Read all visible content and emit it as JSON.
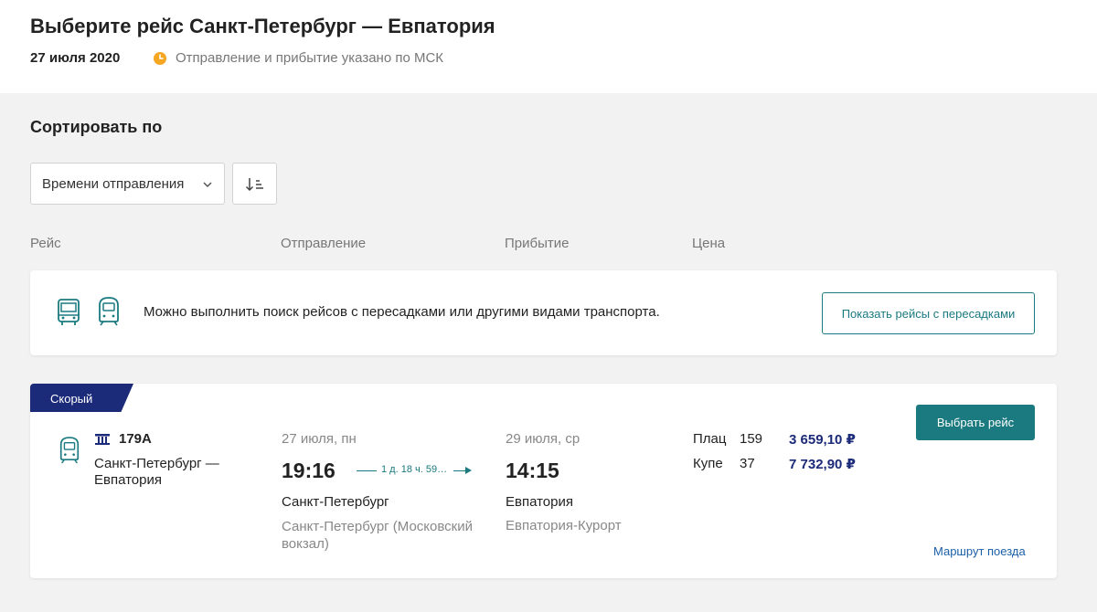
{
  "header": {
    "title": "Выберите рейс Санкт-Петербург — Евпатория",
    "date": "27 июля 2020",
    "timezone_note": "Отправление и прибытие указано по МСК",
    "timezone_icon": "clock-icon"
  },
  "sort": {
    "title": "Сортировать по",
    "selected": "Времени отправления",
    "order_icon": "sort-descending-icon"
  },
  "columns": {
    "route": "Рейс",
    "departure": "Отправление",
    "arrival": "Прибытие",
    "price": "Цена"
  },
  "info_banner": {
    "text": "Можно выполнить поиск рейсов с пересадками или другими видами транспорта.",
    "button_label": "Показать рейсы с пересадками",
    "icons": [
      "bus-icon",
      "train-icon"
    ]
  },
  "trains": [
    {
      "badge": "Скорый",
      "number": "179А",
      "route_name": "Санкт-Петербург — Евпатория",
      "departure": {
        "date": "27 июля, пн",
        "time": "19:16",
        "city": "Санкт-Петербург",
        "station": "Санкт-Петербург (Московский вокзал)"
      },
      "duration": "1 д. 18 ч. 59…",
      "arrival": {
        "date": "29 июля, ср",
        "time": "14:15",
        "city": "Евпатория",
        "station": "Евпатория-Курорт"
      },
      "fares": [
        {
          "class": "Плац",
          "seats": "159",
          "price": "3 659,10 ₽"
        },
        {
          "class": "Купе",
          "seats": "37",
          "price": "7 732,90 ₽"
        }
      ],
      "select_label": "Выбрать рейс",
      "route_link": "Маршрут поезда"
    }
  ],
  "colors": {
    "accent": "#1a7a80",
    "badge": "#1b2a79",
    "price": "#1b2a79",
    "link": "#1a5fa8",
    "clock": "#f5a623"
  }
}
